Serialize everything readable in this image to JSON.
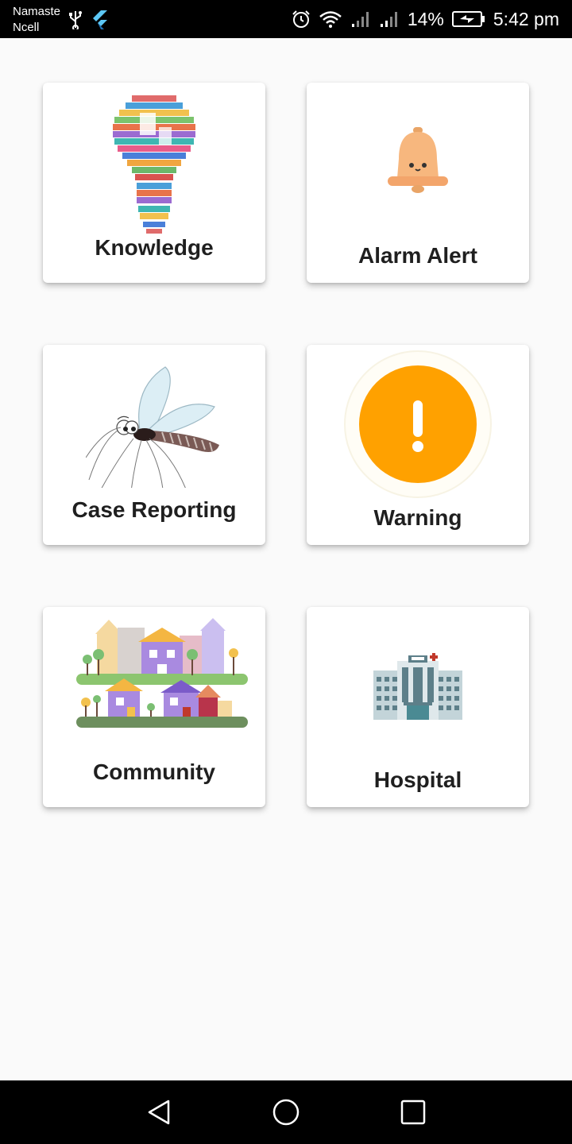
{
  "status_bar": {
    "carrier_line1": "Namaste",
    "carrier_line2": "Ncell",
    "battery": "14%",
    "time": "5:42 pm",
    "icons": [
      "usb-icon",
      "flutter-icon",
      "alarm-icon",
      "wifi-icon",
      "signal-icon",
      "signal-icon",
      "battery-icon"
    ]
  },
  "cards": [
    {
      "id": "knowledge",
      "label": "Knowledge",
      "icon": "lightbulb-books-icon"
    },
    {
      "id": "alarm",
      "label": "Alarm Alert",
      "icon": "bell-icon"
    },
    {
      "id": "case",
      "label": "Case Reporting",
      "icon": "mosquito-icon"
    },
    {
      "id": "warning",
      "label": "Warning",
      "icon": "warning-icon"
    },
    {
      "id": "community",
      "label": "Community",
      "icon": "houses-icon"
    },
    {
      "id": "hospital",
      "label": "Hospital",
      "icon": "hospital-building-icon"
    }
  ],
  "colors": {
    "warning_orange": "#FFA100",
    "bell_peach": "#F7B77E",
    "background": "#FAFAFA",
    "card": "#FFFFFF"
  },
  "nav_bar": {
    "icons": [
      "back-icon",
      "home-icon",
      "recents-icon"
    ]
  }
}
